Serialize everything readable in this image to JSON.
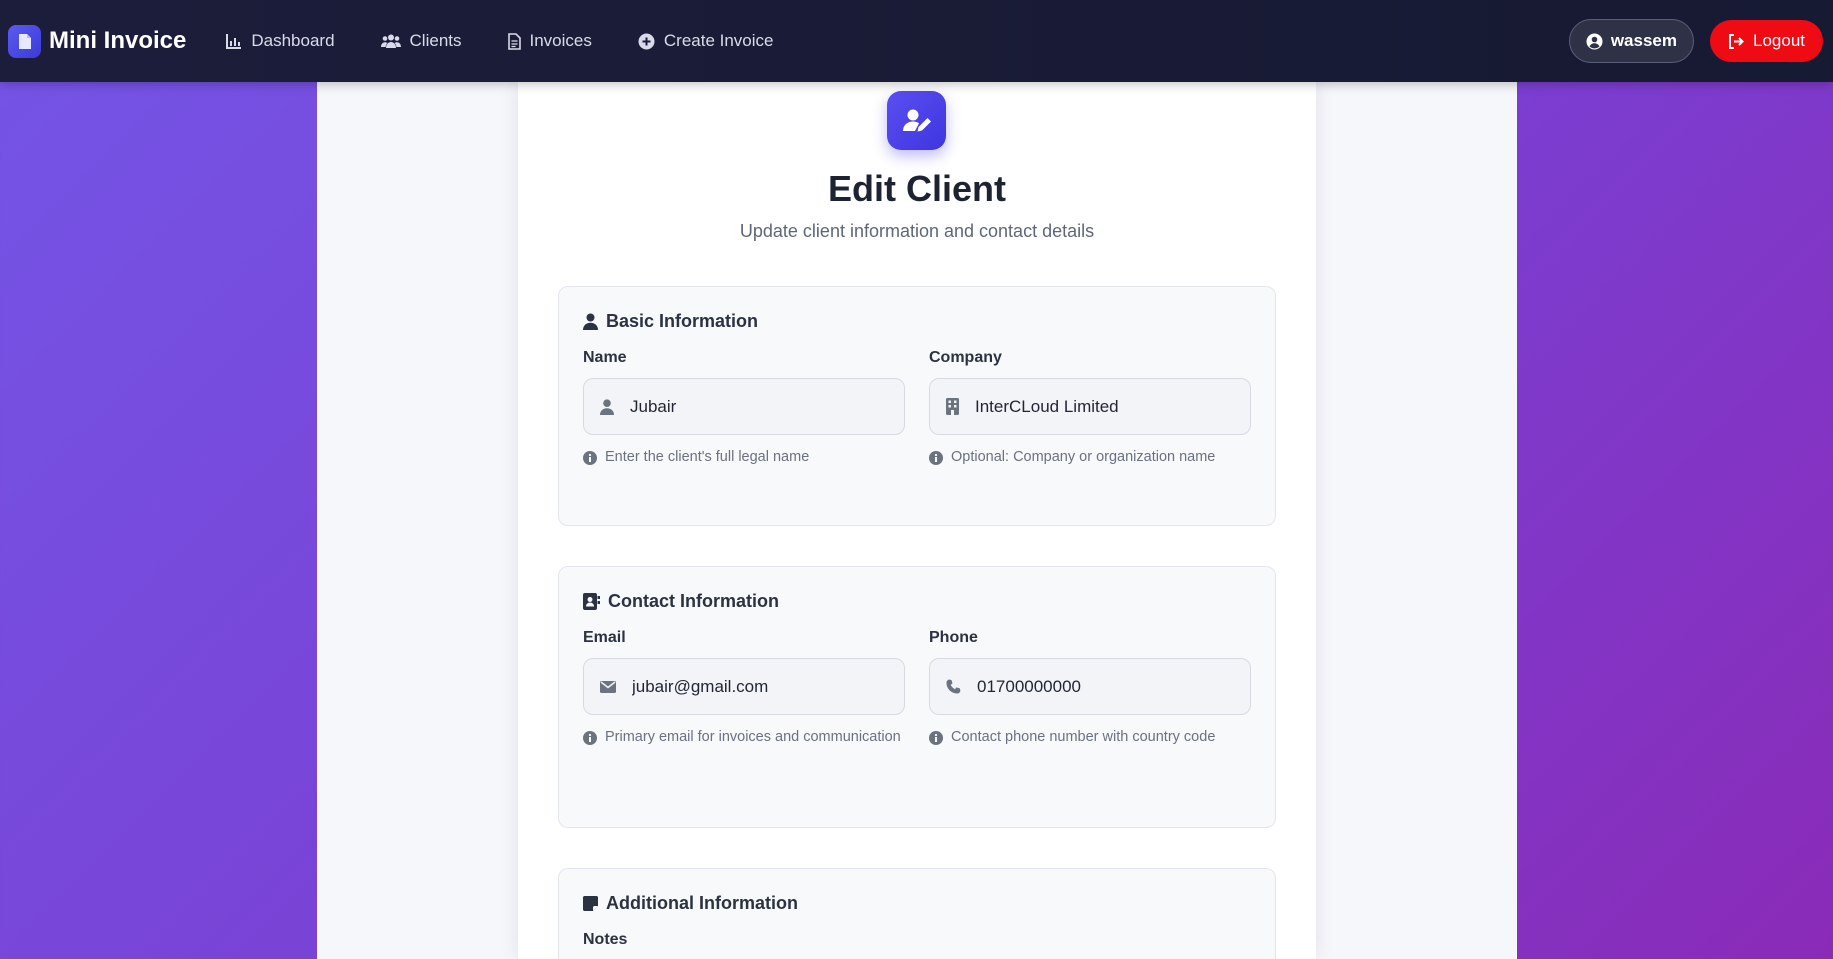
{
  "navbar": {
    "brand": "Mini Invoice",
    "links": [
      {
        "label": "Dashboard",
        "icon": "chart-icon"
      },
      {
        "label": "Clients",
        "icon": "users-icon"
      },
      {
        "label": "Invoices",
        "icon": "file-icon"
      },
      {
        "label": "Create Invoice",
        "icon": "plus-circle-icon"
      }
    ],
    "user": "wassem",
    "logout": "Logout"
  },
  "page": {
    "title": "Edit Client",
    "subtitle": "Update client information and contact details"
  },
  "sections": {
    "basic": {
      "title": "Basic Information",
      "name_label": "Name",
      "name_value": "Jubair",
      "name_hint": "Enter the client's full legal name",
      "company_label": "Company",
      "company_value": "InterCLoud Limited",
      "company_hint": "Optional: Company or organization name"
    },
    "contact": {
      "title": "Contact Information",
      "email_label": "Email",
      "email_value": "jubair@gmail.com",
      "email_hint": "Primary email for invoices and communication",
      "phone_label": "Phone",
      "phone_value": "01700000000",
      "phone_hint": "Contact phone number with country code"
    },
    "additional": {
      "title": "Additional Information",
      "notes_label": "Notes"
    }
  },
  "colors": {
    "accent": "#4f46e5",
    "logout": "#ee0b14",
    "navbar": "#1c1d3a",
    "background_gradient_start": "#7455e6",
    "background_gradient_end": "#8a2bb8"
  }
}
